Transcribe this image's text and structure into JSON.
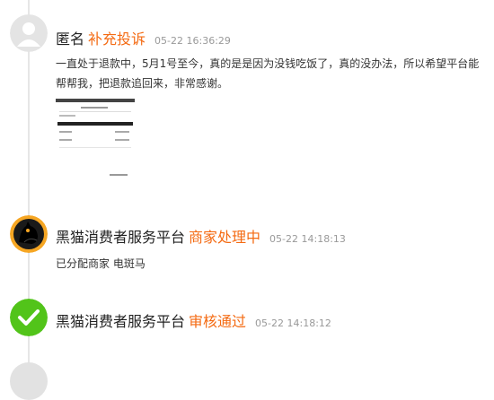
{
  "entries": [
    {
      "name": "匿名",
      "status": "补充投诉",
      "time": "05-22 16:36:29",
      "text": "一直处于退款中，5月1号至今，真的是是因为没钱吃饭了，真的没办法，所以希望平台能帮帮我，把退款追回来，非常感谢。",
      "avatar_icon": "default-user-avatar-icon"
    },
    {
      "name": "黑猫消费者服务平台",
      "status": "商家处理中",
      "time": "05-22 14:18:13",
      "text": "已分配商家 电斑马",
      "avatar_icon": "black-cat-logo-icon"
    },
    {
      "name": "黑猫消费者服务平台",
      "status": "审核通过",
      "time": "05-22 14:18:12",
      "avatar_icon": "green-checkmark-icon"
    }
  ],
  "colors": {
    "status": "#f46a12",
    "check_green": "#52c41a",
    "cat_ring": "#f6a623"
  }
}
